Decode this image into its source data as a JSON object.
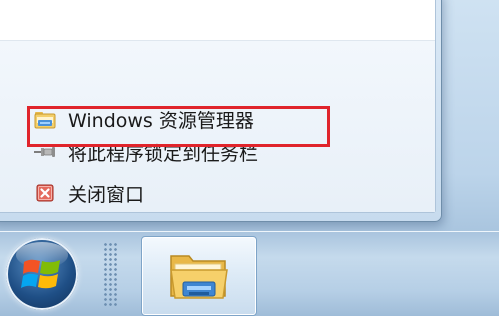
{
  "jump_list": {
    "tasks": [
      {
        "label": "Windows 资源管理器",
        "icon": "folder-explorer-icon"
      },
      {
        "label": "将此程序锁定到任务栏",
        "icon": "pin-icon"
      },
      {
        "label": "关闭窗口",
        "icon": "close-window-icon"
      }
    ]
  },
  "taskbar": {
    "start_icon": "windows-logo-icon",
    "pinned": [
      {
        "icon": "folder-explorer-icon",
        "active": true
      }
    ]
  },
  "colors": {
    "highlight": "#e0242b",
    "taskbar": "#b6cfe6"
  }
}
